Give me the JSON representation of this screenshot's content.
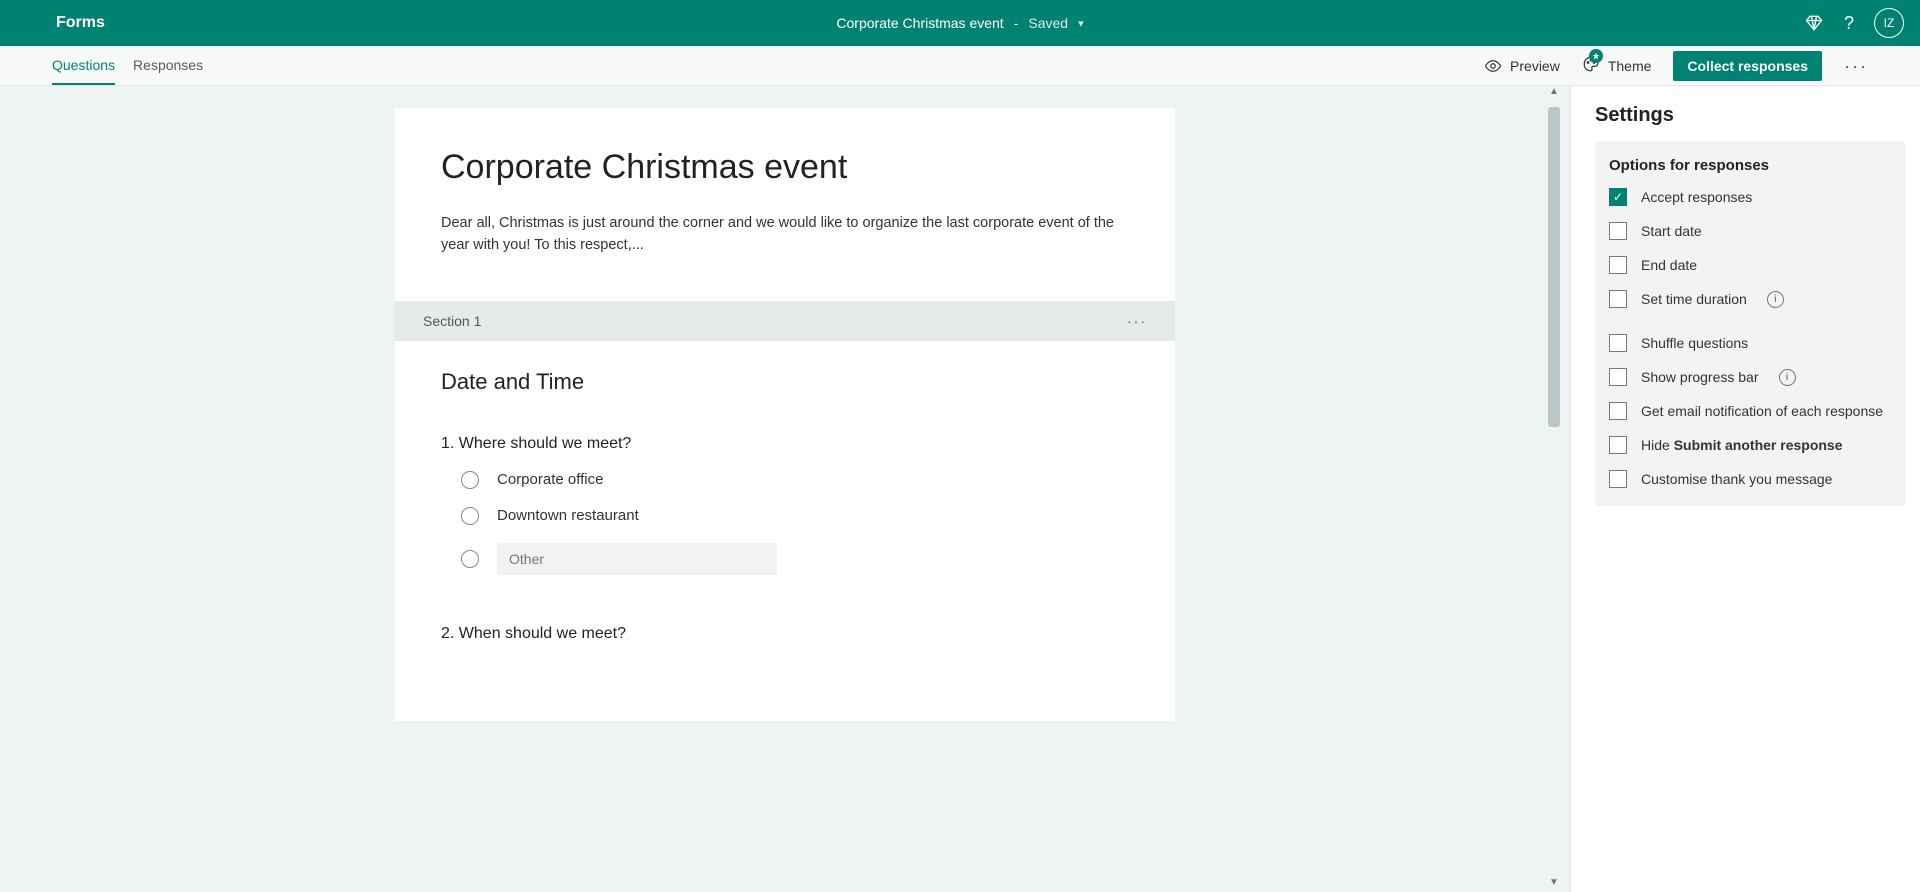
{
  "topbar": {
    "app_name": "Forms",
    "form_title": "Corporate Christmas event",
    "save_state": "Saved",
    "avatar_initials": "IZ"
  },
  "cmdbar": {
    "tabs": {
      "questions": "Questions",
      "responses": "Responses"
    },
    "preview": "Preview",
    "theme": "Theme",
    "collect": "Collect responses"
  },
  "form": {
    "title": "Corporate Christmas event",
    "description": "Dear all, Christmas is just around the corner and we would like to organize the last corporate event of the year with you! To this respect,...",
    "section_label": "Section 1",
    "section_title": "Date and Time",
    "q1": {
      "number": "1.",
      "text": "Where should we meet?",
      "opt1": "Corporate office",
      "opt2": "Downtown restaurant",
      "other_placeholder": "Other"
    },
    "q2": {
      "number": "2.",
      "text": "When should we meet?"
    }
  },
  "settings": {
    "title": "Settings",
    "panel_title": "Options for responses",
    "accept": "Accept responses",
    "start_date": "Start date",
    "end_date": "End date",
    "set_duration": "Set time duration",
    "shuffle": "Shuffle questions",
    "progress_bar": "Show progress bar",
    "email_notify": "Get email notification of each response",
    "hide_prefix": "Hide ",
    "hide_bold": "Submit another response",
    "custom_thank": "Customise thank you message"
  }
}
